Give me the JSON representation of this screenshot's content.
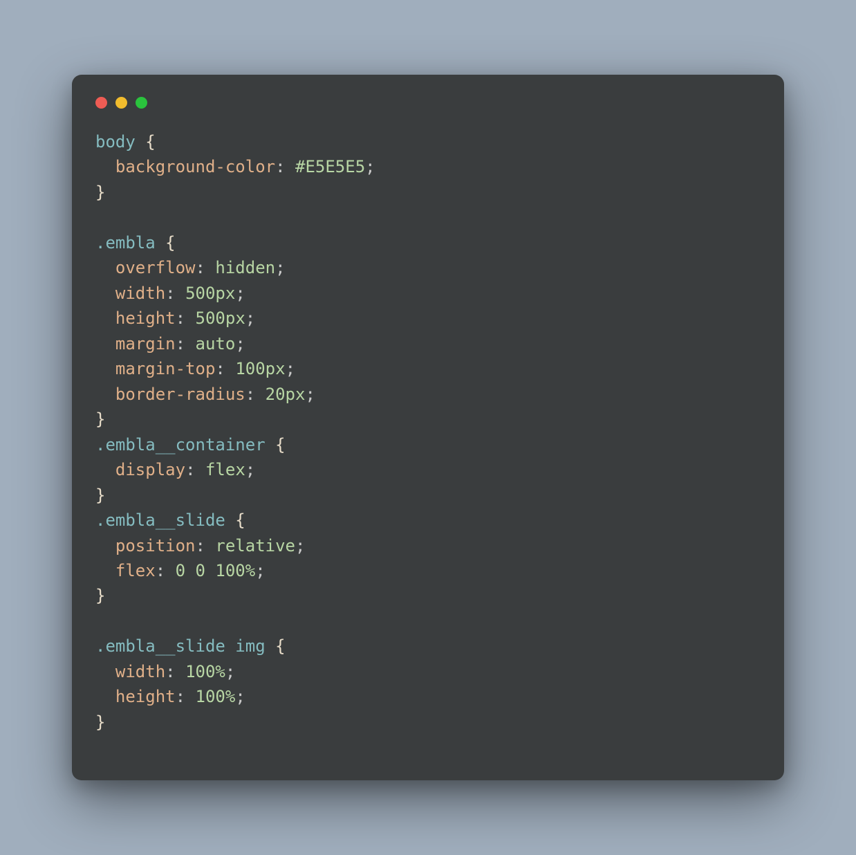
{
  "code": {
    "rules": [
      {
        "selector": "body",
        "isTag": true,
        "leadingBlank": false,
        "declarations": [
          {
            "prop": "background-color",
            "value": "#E5E5E5"
          }
        ]
      },
      {
        "selector": ".embla",
        "isTag": false,
        "leadingBlank": true,
        "declarations": [
          {
            "prop": "overflow",
            "value": "hidden"
          },
          {
            "prop": "width",
            "value": "500px"
          },
          {
            "prop": "height",
            "value": "500px"
          },
          {
            "prop": "margin",
            "value": "auto"
          },
          {
            "prop": "margin-top",
            "value": "100px"
          },
          {
            "prop": "border-radius",
            "value": "20px"
          }
        ]
      },
      {
        "selector": ".embla__container",
        "isTag": false,
        "leadingBlank": false,
        "declarations": [
          {
            "prop": "display",
            "value": "flex"
          }
        ]
      },
      {
        "selector": ".embla__slide",
        "isTag": false,
        "leadingBlank": false,
        "declarations": [
          {
            "prop": "position",
            "value": "relative"
          },
          {
            "prop": "flex",
            "value": "0 0 100%"
          }
        ]
      },
      {
        "selector": ".embla__slide img",
        "selectorParts": [
          {
            "text": ".embla__slide",
            "isTag": false
          },
          {
            "text": " ",
            "isSpace": true
          },
          {
            "text": "img",
            "isTag": true
          }
        ],
        "isTag": false,
        "leadingBlank": true,
        "declarations": [
          {
            "prop": "width",
            "value": "100%"
          },
          {
            "prop": "height",
            "value": "100%"
          }
        ]
      }
    ]
  }
}
